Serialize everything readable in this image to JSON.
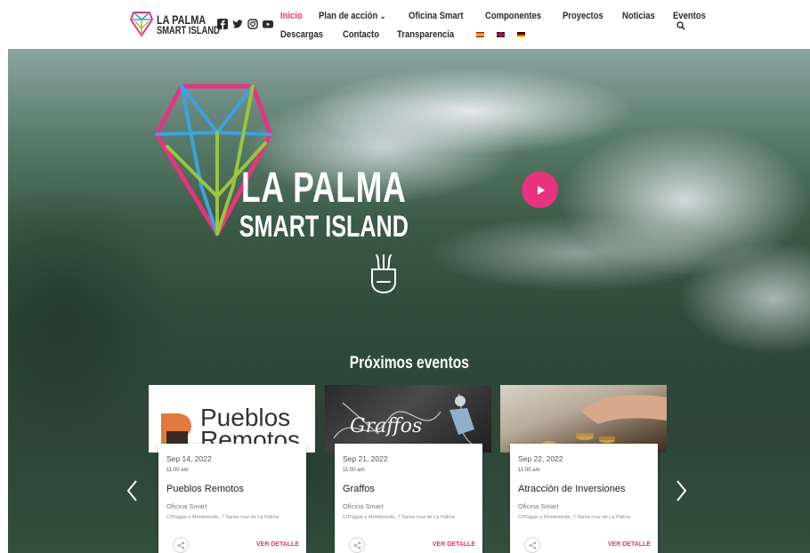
{
  "brand": {
    "name_line1": "LA PALMA",
    "name_line2": "SMART ISLAND",
    "colors": {
      "pink": "#e8337f",
      "blue": "#3aa3e0",
      "green": "#9bc53d",
      "text": "#2a2a2a"
    }
  },
  "social": [
    "facebook-icon",
    "twitter-icon",
    "instagram-icon",
    "youtube-icon"
  ],
  "nav": {
    "row1": [
      {
        "label": "Inicio",
        "active": true
      },
      {
        "label": "Plan de acción",
        "dropdown": true
      },
      {
        "label": "Oficina Smart"
      },
      {
        "label": "Componentes"
      },
      {
        "label": "Proyectos"
      },
      {
        "label": "Noticias"
      },
      {
        "label": "Eventos"
      }
    ],
    "row2": [
      {
        "label": "Descargas"
      },
      {
        "label": "Contacto"
      },
      {
        "label": "Transparencia"
      }
    ],
    "languages": [
      "es-flag-icon",
      "gb-flag-icon",
      "de-flag-icon"
    ]
  },
  "hero": {
    "title_line1": "LA PALMA",
    "title_line2": "SMART ISLAND"
  },
  "events": {
    "heading": "Próximos eventos",
    "items": [
      {
        "image_text_1": "Pueblos",
        "image_text_2": "Remotos",
        "date": "Sep 14, 2022",
        "time": "11:00 am",
        "title": "Pueblos Remotos",
        "organizer": "Oficina Smart",
        "address": "C/Poggio y Monteverde, 7 Santa cruz de La Palma",
        "cta": "VER DETALLE"
      },
      {
        "image_text_1": "Graffos",
        "date": "Sep 21, 2022",
        "time": "11:00 am",
        "title": "Graffos",
        "organizer": "Oficina Smart",
        "address": "C/Poggio y Monteverde, 7 Santa cruz de La Palma",
        "cta": "VER DETALLE"
      },
      {
        "date": "Sep 22, 2022",
        "time": "11:00 am",
        "title": "Atracción de Inversiones",
        "organizer": "Oficina Smart",
        "address": "C/Poggio y Monteverde, 7 Santa cruz de La Palma",
        "cta": "VER DETALLE"
      }
    ]
  }
}
